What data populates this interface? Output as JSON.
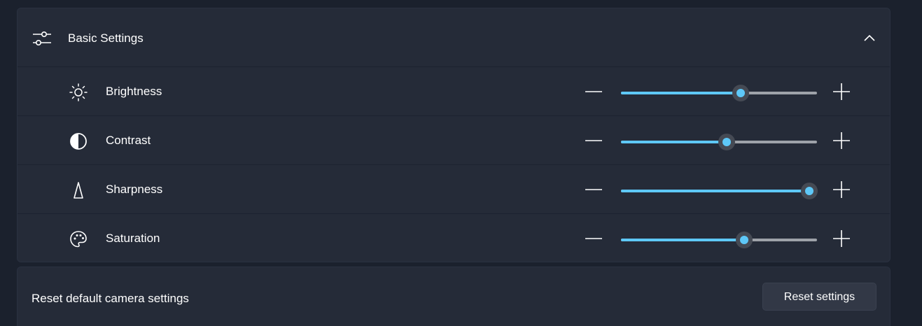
{
  "section": {
    "title": "Basic Settings",
    "icon": "sliders-icon",
    "expanded": true
  },
  "settings": [
    {
      "label": "Brightness",
      "icon": "sun-icon",
      "value_fraction": 0.61
    },
    {
      "label": "Contrast",
      "icon": "contrast-icon",
      "value_fraction": 0.54
    },
    {
      "label": "Sharpness",
      "icon": "sharpness-icon",
      "value_fraction": 0.96
    },
    {
      "label": "Saturation",
      "icon": "palette-icon",
      "value_fraction": 0.63
    }
  ],
  "reset": {
    "label": "Reset default camera settings",
    "button_label": "Reset settings"
  },
  "colors": {
    "accent": "#5ec8f8",
    "track": "#9ea2a9",
    "panel": "#252b38",
    "background": "#1b212d"
  }
}
